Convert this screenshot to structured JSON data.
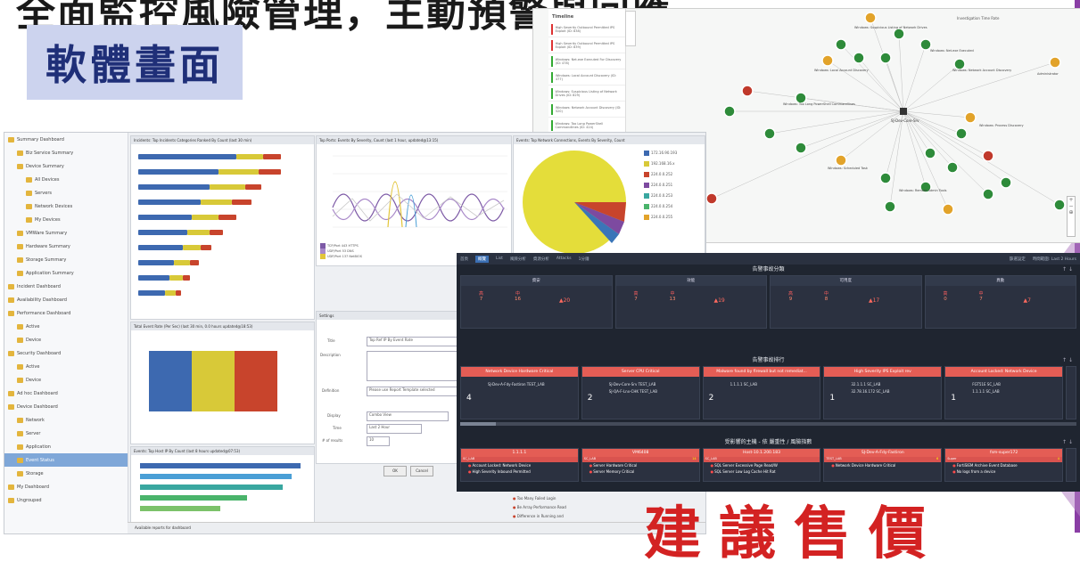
{
  "slide": {
    "headline": "全面監控風險管理，主動預警與回應",
    "badge": "軟體畫面",
    "suggest": "建議售價",
    "accent": "#8a3ea5",
    "badge_bg": "#ccd3ee"
  },
  "graph_screen": {
    "timeline": {
      "title": "Timeline",
      "items": [
        {
          "label": "High Severity Outbound Permitted IPS Exploit (ID: 838)",
          "color": "#d33"
        },
        {
          "label": "High Severity Outbound Permitted IPS Exploit (ID: 839)",
          "color": "#d33"
        },
        {
          "label": "Windows: Net.exe Executed For Discovery (ID: 478)",
          "color": "#3a3"
        },
        {
          "label": "Windows: Local Account Discovery (ID: 477)",
          "color": "#3a3"
        },
        {
          "label": "Windows: Suspicious Listing of Network Drives (ID: 829)",
          "color": "#3a3"
        },
        {
          "label": "Windows: Network Account Discovery (ID: 520)",
          "color": "#3a3"
        },
        {
          "label": "Windows: Too Long PowerShell Commandlines (ID: 424)",
          "color": "#3a3"
        }
      ]
    },
    "investigation": "Investigation Time Rate",
    "center_node": "SJ-Dev-Core-Srv",
    "node_labels": [
      "Windows: Suspicious Listing of Network Drives",
      "Windows: Net.exe Executed",
      "Windows: Local Account Discovery",
      "Windows: Network Account Discovery",
      "Windows: Too Long PowerShell Commandlines",
      "Windows: Process Discovery",
      "Windows: Remote Admin Tools",
      "Windows: Scheduled Task"
    ],
    "admin_label": "Administrator"
  },
  "siem_screen": {
    "tree": [
      {
        "label": "Summary Dashboard",
        "indent": 0,
        "sel": false
      },
      {
        "label": "Biz Service Summary",
        "indent": 1,
        "sel": false
      },
      {
        "label": "Device Summary",
        "indent": 1,
        "sel": false
      },
      {
        "label": "All Devices",
        "indent": 2,
        "sel": false
      },
      {
        "label": "Servers",
        "indent": 2,
        "sel": false
      },
      {
        "label": "Network Devices",
        "indent": 2,
        "sel": false
      },
      {
        "label": "My Devices",
        "indent": 2,
        "sel": false
      },
      {
        "label": "VMWare Summary",
        "indent": 1,
        "sel": false
      },
      {
        "label": "Hardware Summary",
        "indent": 1,
        "sel": false
      },
      {
        "label": "Storage Summary",
        "indent": 1,
        "sel": false
      },
      {
        "label": "Application Summary",
        "indent": 1,
        "sel": false
      },
      {
        "label": "Incident Dashboard",
        "indent": 0,
        "sel": false
      },
      {
        "label": "Availability Dashboard",
        "indent": 0,
        "sel": false
      },
      {
        "label": "Performance Dashboard",
        "indent": 0,
        "sel": false
      },
      {
        "label": "Active",
        "indent": 1,
        "sel": false
      },
      {
        "label": "Device",
        "indent": 1,
        "sel": false
      },
      {
        "label": "Security Dashboard",
        "indent": 0,
        "sel": false
      },
      {
        "label": "Active",
        "indent": 1,
        "sel": false
      },
      {
        "label": "Device",
        "indent": 1,
        "sel": false
      },
      {
        "label": "Ad hoc Dashboard",
        "indent": 0,
        "sel": false
      },
      {
        "label": "Device Dashboard",
        "indent": 0,
        "sel": false
      },
      {
        "label": "Network",
        "indent": 1,
        "sel": false
      },
      {
        "label": "Server",
        "indent": 1,
        "sel": false
      },
      {
        "label": "Application",
        "indent": 1,
        "sel": false
      },
      {
        "label": "Event Status",
        "indent": 1,
        "sel": true
      },
      {
        "label": "Storage",
        "indent": 1,
        "sel": false
      },
      {
        "label": "My Dashboard",
        "indent": 0,
        "sel": false
      },
      {
        "label": "Ungrouped",
        "indent": 0,
        "sel": false
      }
    ],
    "panel1_title": "Incidents: Top Incidents Categories Ranked By Count (last 30 min)",
    "panel2_title": "Top Ports: Events By Severity, Count (last 1 hour, updated@13:15)",
    "panel3_title": "Events: Top Network Connections, Events By Severity, Count",
    "panel4_title": "Total Event Rate (Per Sec) (last 30 min, 0.0 hours updated@18:53)",
    "panel5_title": "Events: Top Host IP By Count (last 8 hours updated@07:53)",
    "settings": {
      "title": "Settings",
      "name_label": "Title",
      "name_value": "Top Ref IP By Event Rate",
      "desc_label": "Description",
      "def_label": "Definition",
      "def_value": "Please use Report Template selected",
      "display_label": "Display",
      "display_value": "Combo View",
      "time_label": "Time",
      "time_value": "Last 2 Hour",
      "results_label": "# of results",
      "results_value": "10",
      "ok": "OK",
      "cancel": "Cancel"
    },
    "pie_legend": [
      "172.16.90.193",
      "192.168.16.x",
      "224.0.0.252",
      "224.0.0.251",
      "224.0.0.253",
      "224.0.0.254",
      "224.0.0.255"
    ],
    "rank_list": [
      "High Severity Outbound Permitted",
      "Too Many Failed Login",
      "Be Array Performance Read",
      "Difference in Running and"
    ],
    "status": "Available reports for dashboard"
  },
  "alert_screen": {
    "nav": [
      {
        "label": "首頁",
        "active": false
      },
      {
        "label": "概覽",
        "active": true
      },
      {
        "label": "List",
        "active": false
      },
      {
        "label": "風險分析",
        "active": false
      },
      {
        "label": "資源分析",
        "active": false
      },
      {
        "label": "Attacks",
        "active": false
      },
      {
        "label": "1分鐘",
        "active": false
      }
    ],
    "nav_right": [
      "篩選設定",
      "時間範圍: Last 2 Hours"
    ],
    "classify_title": "告警事故分類",
    "classify": [
      {
        "name": "資安",
        "high": 7,
        "mid": 16,
        "delta": 20
      },
      {
        "name": "效能",
        "high": 7,
        "mid": 13,
        "delta": 19
      },
      {
        "name": "可用度",
        "high": 9,
        "mid": 8,
        "delta": 17
      },
      {
        "name": "異動",
        "high": 0,
        "mid": 7,
        "delta": 7
      }
    ],
    "high_label": "高",
    "mid_label": "中",
    "rank_title": "告警事故排行",
    "rank": [
      {
        "name": "Network Device Hardware Critical",
        "count": 4,
        "lines": [
          "SJ-Dev-A-Fdy-Fastiron  TEST_LAB"
        ]
      },
      {
        "name": "Server CPU Critical",
        "count": 2,
        "lines": [
          "SJ-Dev-Core-Srv  TEST_LAB",
          "SJ-QA-F-Lnx-CHK  TEST_LAB"
        ]
      },
      {
        "name": "Malware found by firewall but not remediat...",
        "count": 2,
        "lines": [
          "1.1.1.1  SC_LAB"
        ]
      },
      {
        "name": "High Severity IPS Exploit rev",
        "count": 1,
        "lines": [
          "32.1.1.1  SC_LAB",
          "32.78.16.172  SC_LAB"
        ]
      },
      {
        "name": "Account Locked: Network Device",
        "count": 1,
        "lines": [
          "FGT51E  SC_LAB",
          "1.1.1.1  SC_LAB"
        ]
      }
    ],
    "host_title": "受影響的主機 - 依  嚴重性  /  風險指數",
    "hosts": [
      {
        "name": "1.1.1.1",
        "sub": "SC_LAB",
        "score": "",
        "lines": [
          "Account Locked: Network Device",
          "High Severity Inbound Permitted"
        ]
      },
      {
        "name": "VM6408",
        "sub": "SC_LAB",
        "score": "14",
        "lines": [
          "Server Hardware Critical",
          "Server Memory Critical"
        ]
      },
      {
        "name": "Host-10.1.200.183",
        "sub": "SC_LAB",
        "score": "",
        "lines": [
          "SQL Server Excessive Page Read/W",
          "SQL Server Low Log Cache Hit Rat"
        ]
      },
      {
        "name": "SJ-Dev-A-Fdy-Fastiron",
        "sub": "TEST_LAB",
        "score": "6",
        "lines": [
          "Network Device Hardware Critical"
        ]
      },
      {
        "name": "fsm-super172",
        "sub": "Super",
        "score": "4",
        "lines": [
          "FortiSIEM Archive Event Database",
          "No logs from a device"
        ]
      }
    ]
  }
}
